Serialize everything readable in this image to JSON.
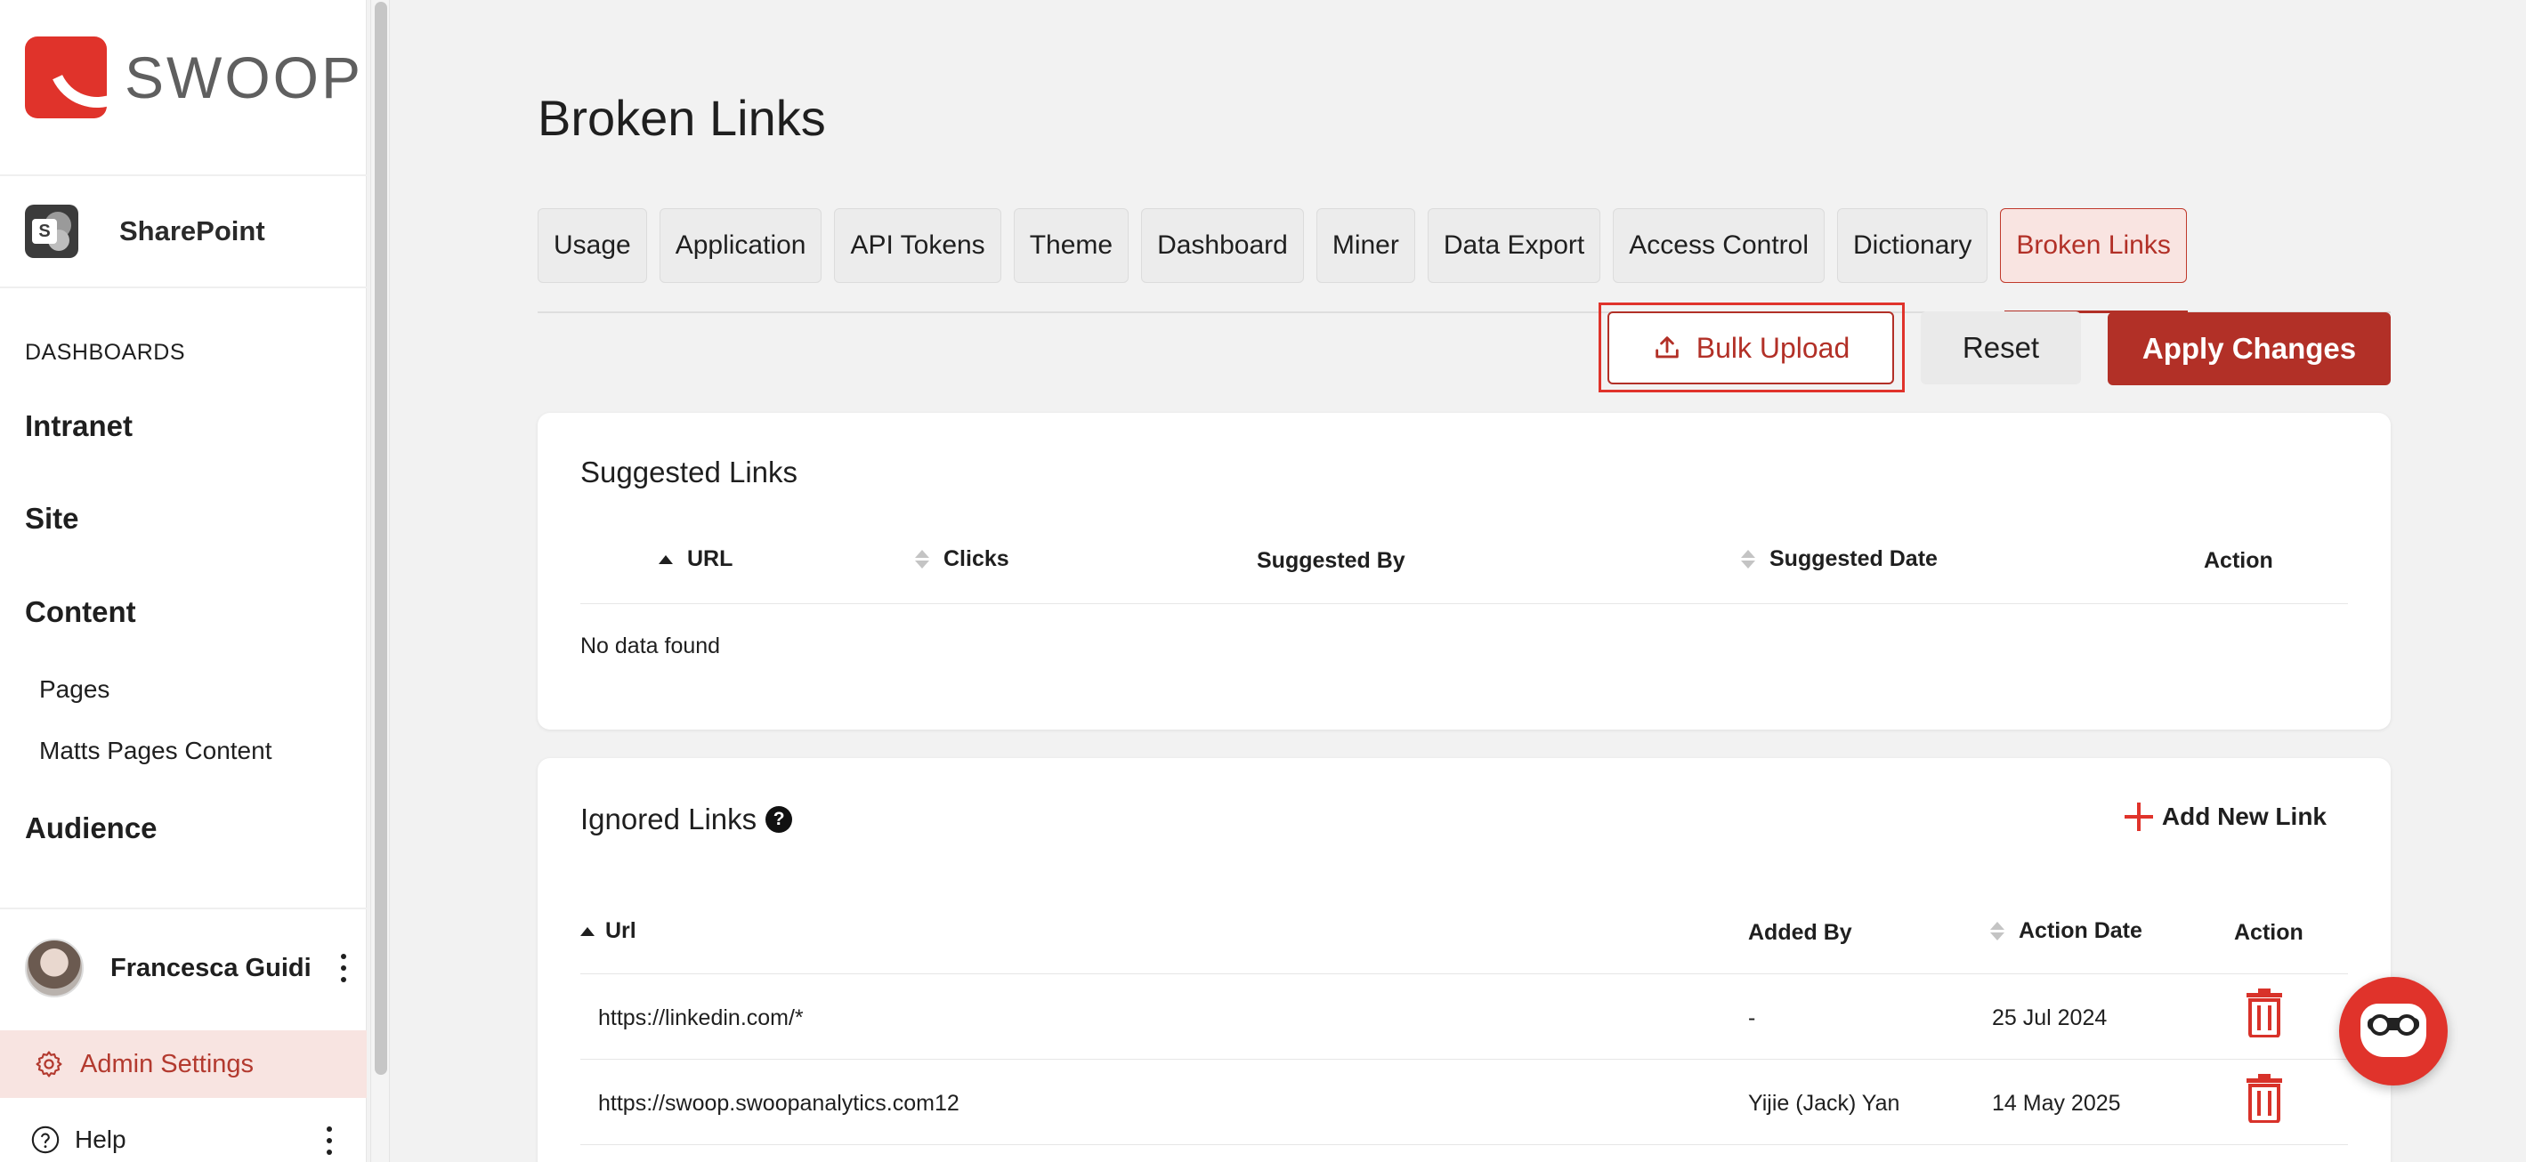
{
  "brand": {
    "name": "SWOOP",
    "accent": "#b23027",
    "logo_red": "#e0332b"
  },
  "sidebar": {
    "platform": "SharePoint",
    "section_label": "DASHBOARDS",
    "items": [
      "Intranet",
      "Site",
      "Content",
      "Audience"
    ],
    "content_subitems": [
      "Pages",
      "Matts Pages Content"
    ],
    "user_name": "Francesca Guidi",
    "admin_label": "Admin Settings",
    "help_label": "Help"
  },
  "page": {
    "title": "Broken Links"
  },
  "tabs": [
    "Usage",
    "Application",
    "API Tokens",
    "Theme",
    "Dashboard",
    "Miner",
    "Data Export",
    "Access Control",
    "Dictionary",
    "Broken Links"
  ],
  "active_tab": "Broken Links",
  "actions": {
    "bulk_upload": "Bulk Upload",
    "reset": "Reset",
    "apply": "Apply Changes"
  },
  "suggested": {
    "title": "Suggested Links",
    "columns": [
      "URL",
      "Clicks",
      "Suggested By",
      "Suggested Date",
      "Action"
    ],
    "empty_text": "No data found"
  },
  "ignored": {
    "title": "Ignored Links",
    "add_label": "Add New Link",
    "columns": [
      "Url",
      "Added By",
      "Action Date",
      "Action"
    ],
    "rows": [
      {
        "url": "https://linkedin.com/*",
        "added_by": "-",
        "date": "25 Jul 2024"
      },
      {
        "url": "https://swoop.swoopanalytics.com12",
        "added_by": "Yijie (Jack) Yan",
        "date": "14 May 2025"
      }
    ]
  }
}
